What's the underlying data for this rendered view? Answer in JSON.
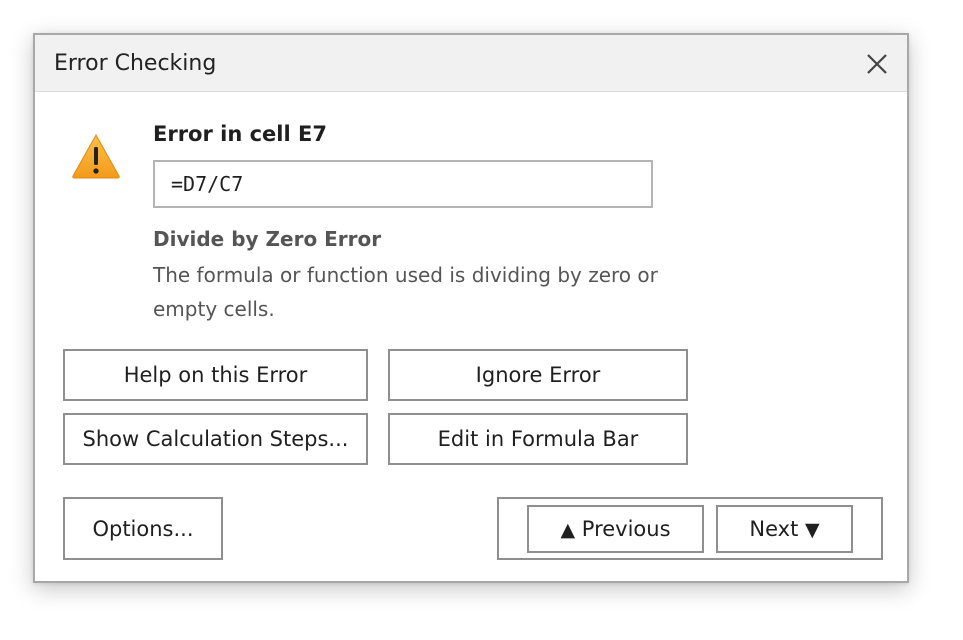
{
  "dialog": {
    "title": "Error Checking",
    "close_icon": "close-icon"
  },
  "error": {
    "icon": "warning-icon",
    "heading": "Error in cell E7",
    "formula": "=D7/C7",
    "type": "Divide by Zero Error",
    "description": "The formula or function used is dividing by zero or empty cells."
  },
  "buttons": {
    "help": "Help on this Error",
    "ignore": "Ignore Error",
    "steps": "Show Calculation Steps...",
    "edit": "Edit in Formula Bar",
    "options": "Options..."
  },
  "nav": {
    "previous_arrow": "▲",
    "previous_label": "Previous",
    "next_label": "Next",
    "next_arrow": "▼"
  },
  "colors": {
    "warning_fill": "#F6A623",
    "warning_mark": "#222222",
    "border": "#8F8F8F",
    "titlebar": "#F1F1F1"
  }
}
